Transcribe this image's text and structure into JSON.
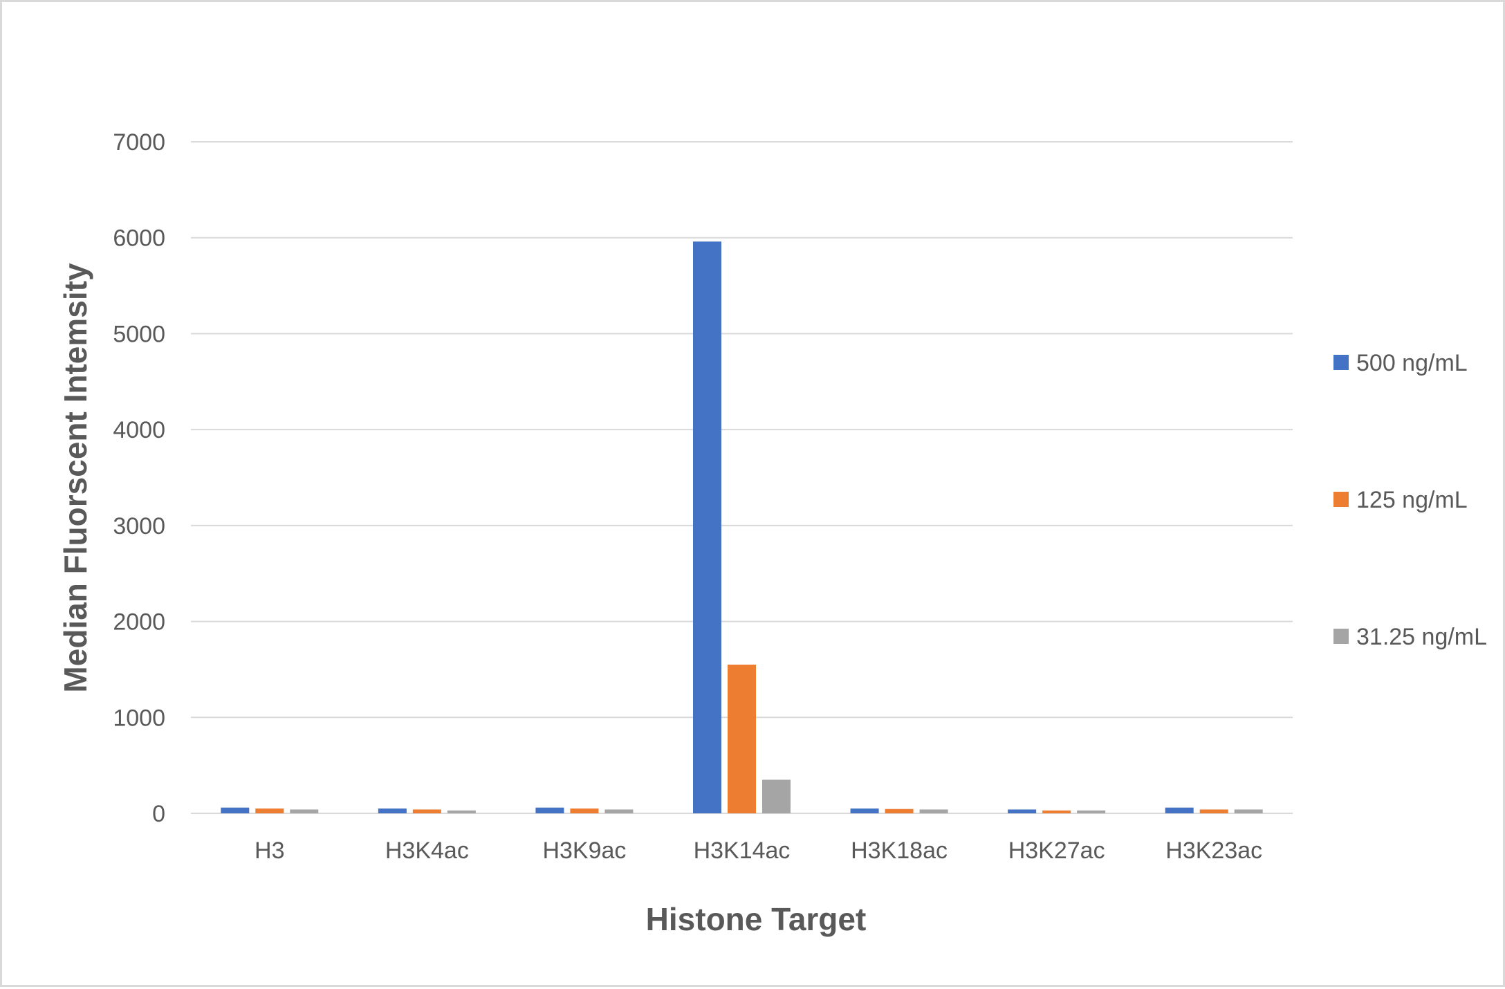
{
  "chart_data": {
    "type": "bar",
    "title": "",
    "xlabel": "Histone Target",
    "ylabel": "Median Fluorscent Intemsity",
    "categories": [
      "H3",
      "H3K4ac",
      "H3K9ac",
      "H3K14ac",
      "H3K18ac",
      "H3K27ac",
      "H3K23ac"
    ],
    "series": [
      {
        "name": "500 ng/mL",
        "color": "#4472c4",
        "values": [
          60,
          50,
          60,
          5960,
          50,
          40,
          60
        ]
      },
      {
        "name": "125 ng/mL",
        "color": "#ed7d31",
        "values": [
          50,
          40,
          50,
          1550,
          45,
          30,
          40
        ]
      },
      {
        "name": "31.25 ng/mL",
        "color": "#a5a5a5",
        "values": [
          40,
          30,
          40,
          350,
          40,
          30,
          40
        ]
      }
    ],
    "ylim": [
      0,
      7000
    ],
    "yticks": [
      0,
      1000,
      2000,
      3000,
      4000,
      5000,
      6000,
      7000
    ],
    "grid": true,
    "legend_position": "right"
  }
}
